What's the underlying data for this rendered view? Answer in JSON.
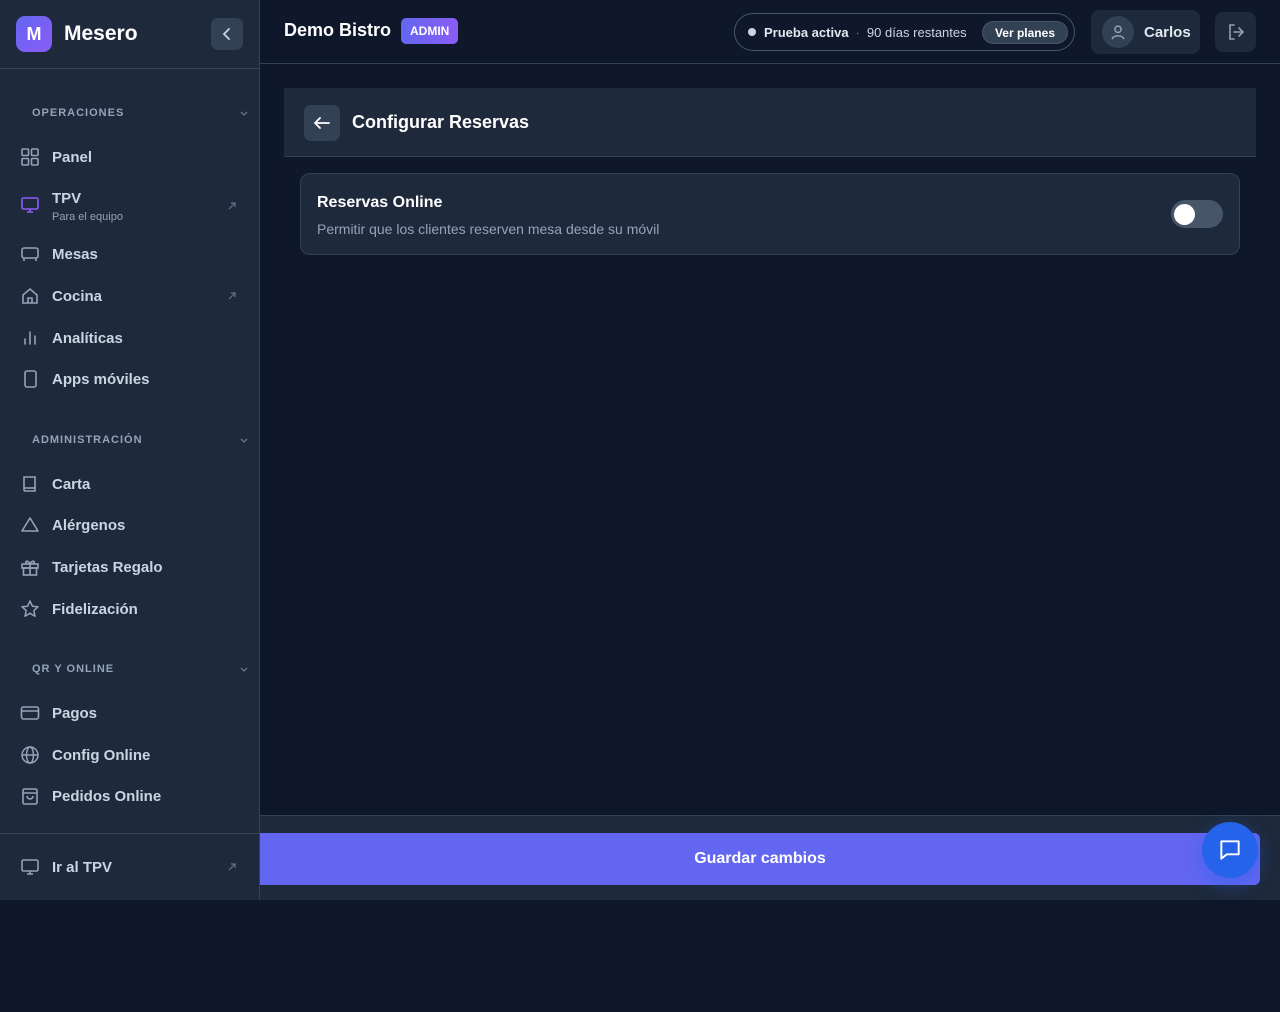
{
  "brand": {
    "logo_letter": "M",
    "name": "Mesero"
  },
  "sections": {
    "operaciones": "OPERACIONES",
    "administracion": "ADMINISTRACIÓN",
    "qr_online": "QR Y ONLINE"
  },
  "nav": {
    "panel": "Panel",
    "tpv": "TPV",
    "tpv_sub": "Para el equipo",
    "mesas": "Mesas",
    "cocina": "Cocina",
    "analiticas": "Analíticas",
    "apps": "Apps móviles",
    "carta": "Carta",
    "alergenos": "Alérgenos",
    "tarjetas": "Tarjetas Regalo",
    "fidelizacion": "Fidelización",
    "pagos": "Pagos",
    "config_online": "Config Online",
    "pedidos_online": "Pedidos Online",
    "ir_tpv": "Ir al TPV"
  },
  "header": {
    "restaurant": "Demo Bistro",
    "role_badge": "ADMIN",
    "trial_status": "Prueba activa",
    "trial_sep": "·",
    "trial_days": "90 días restantes",
    "plans_button": "Ver planes",
    "user_name": "Carlos"
  },
  "page": {
    "title": "Configurar Reservas",
    "setting_title": "Reservas Online",
    "setting_description": "Permitir que los clientes reserven mesa desde su móvil",
    "setting_enabled": false,
    "save_button": "Guardar cambios"
  },
  "icons": {
    "collapse": "chevron-left-icon",
    "panel": "grid-icon",
    "tpv": "monitor-icon",
    "mesas": "table-icon",
    "cocina": "home-icon",
    "analiticas": "bar-chart-icon",
    "apps": "smartphone-icon",
    "carta": "book-icon",
    "alergenos": "warning-triangle-icon",
    "tarjetas": "gift-icon",
    "fidelizacion": "star-icon",
    "pagos": "credit-card-icon",
    "config_online": "globe-icon",
    "pedidos_online": "shopping-bag-icon",
    "ir_tpv": "monitor-icon",
    "user": "user-icon",
    "logout": "logout-icon",
    "back": "arrow-left-icon",
    "chat": "chat-bubble-icon"
  },
  "colors": {
    "accent": "#6366f1",
    "active_nav": "#8b5cf6",
    "background": "#0f172a",
    "surface": "#1e293b",
    "chat": "#2563eb"
  }
}
